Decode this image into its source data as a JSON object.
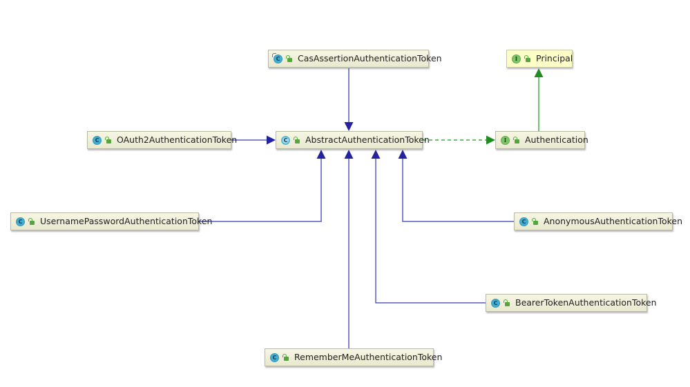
{
  "diagram": {
    "type": "uml-class-hierarchy",
    "colors": {
      "inheritance": "#2323a0",
      "inheritance_line": "#5959c6",
      "implementation": "#1f8c1f",
      "implementation_line": "#3fae3f",
      "node_fill": "#efefd8",
      "interface_node_fill": "#fdfdc8"
    },
    "nodes": [
      {
        "id": "cas",
        "label": "CasAssertionAuthenticationToken",
        "kind": "class",
        "badge": "C",
        "extends_marker": true,
        "visibility": "public"
      },
      {
        "id": "principal",
        "label": "Principal",
        "kind": "interface",
        "badge": "I",
        "visibility": "public",
        "highlighted": true
      },
      {
        "id": "oauth2",
        "label": "OAuth2AuthenticationToken",
        "kind": "class",
        "badge": "C",
        "visibility": "public"
      },
      {
        "id": "abstract",
        "label": "AbstractAuthenticationToken",
        "kind": "abstract-class",
        "badge": "C",
        "visibility": "public"
      },
      {
        "id": "authentication",
        "label": "Authentication",
        "kind": "interface",
        "badge": "I",
        "visibility": "public"
      },
      {
        "id": "username",
        "label": "UsernamePasswordAuthenticationToken",
        "kind": "class",
        "badge": "C",
        "visibility": "public"
      },
      {
        "id": "anonymous",
        "label": "AnonymousAuthenticationToken",
        "kind": "class",
        "badge": "C",
        "visibility": "public"
      },
      {
        "id": "bearer",
        "label": "BearerTokenAuthenticationToken",
        "kind": "class",
        "badge": "C",
        "visibility": "public"
      },
      {
        "id": "rememberme",
        "label": "RememberMeAuthenticationToken",
        "kind": "class",
        "badge": "C",
        "visibility": "public"
      }
    ],
    "edges": [
      {
        "from": "cas",
        "to": "abstract",
        "type": "extends",
        "style": "solid"
      },
      {
        "from": "oauth2",
        "to": "abstract",
        "type": "extends",
        "style": "solid"
      },
      {
        "from": "username",
        "to": "abstract",
        "type": "extends",
        "style": "solid"
      },
      {
        "from": "rememberme",
        "to": "abstract",
        "type": "extends",
        "style": "solid"
      },
      {
        "from": "bearer",
        "to": "abstract",
        "type": "extends",
        "style": "solid"
      },
      {
        "from": "anonymous",
        "to": "abstract",
        "type": "extends",
        "style": "solid"
      },
      {
        "from": "abstract",
        "to": "authentication",
        "type": "implements",
        "style": "dashed"
      },
      {
        "from": "authentication",
        "to": "principal",
        "type": "extends",
        "style": "solid"
      }
    ]
  }
}
